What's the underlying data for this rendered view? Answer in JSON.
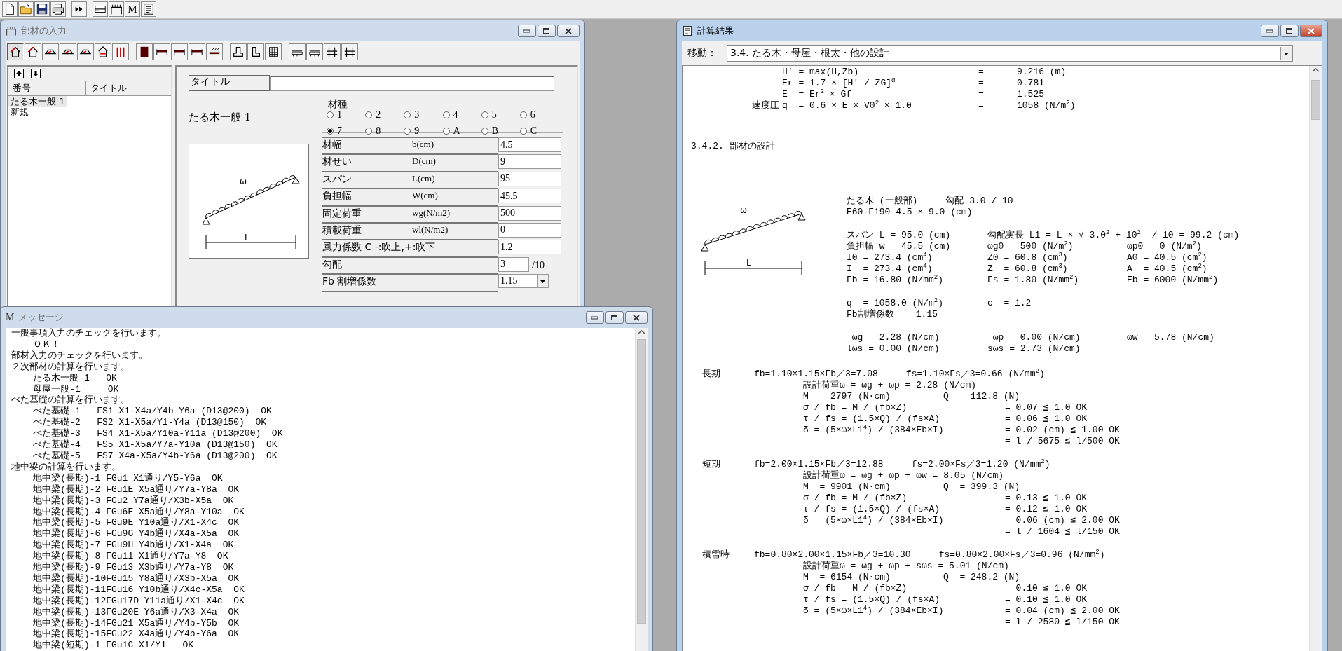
{
  "app_toolbar": {
    "groups": [
      [
        {
          "kind": "page"
        },
        {
          "kind": "folder"
        },
        {
          "kind": "floppy"
        },
        {
          "kind": "printer"
        }
      ],
      [
        {
          "kind": "fast-forward"
        }
      ],
      [
        {
          "kind": "stack"
        },
        {
          "kind": "bench"
        },
        {
          "kind": "letter",
          "text": "M"
        },
        {
          "kind": "document"
        }
      ]
    ]
  },
  "member_window": {
    "title": "部材の入力",
    "tool_groups": [
      [
        {
          "kind": "roof",
          "selected": true
        },
        {
          "kind": "roof",
          "selected": false
        },
        {
          "kind": "hip-roof",
          "selected": false
        },
        {
          "kind": "hip-roof",
          "selected": false
        },
        {
          "kind": "hip-roof",
          "selected": false
        },
        {
          "kind": "house",
          "selected": false
        },
        {
          "kind": "columns",
          "selected": false
        }
      ],
      [
        {
          "kind": "post",
          "selected": false
        },
        {
          "kind": "beam",
          "selected": false
        },
        {
          "kind": "beam",
          "selected": false
        },
        {
          "kind": "beam",
          "selected": false
        },
        {
          "kind": "load",
          "selected": false
        }
      ],
      [
        {
          "kind": "footing",
          "selected": false
        },
        {
          "kind": "l-shape",
          "selected": false
        },
        {
          "kind": "grid",
          "selected": false
        }
      ],
      [
        {
          "kind": "slab",
          "selected": false
        },
        {
          "kind": "slab",
          "selected": false
        },
        {
          "kind": "frame",
          "selected": false
        },
        {
          "kind": "frame",
          "selected": false
        }
      ]
    ],
    "list": {
      "columns": [
        "番号",
        "タイトル"
      ],
      "items": [
        {
          "text": "たる木一般 1",
          "selected": true
        },
        {
          "text": "新規",
          "selected": false
        }
      ]
    },
    "form": {
      "title_label": "タイトル",
      "heading": "たる木一般 1",
      "material": {
        "label": "材種",
        "options": [
          {
            "label": "1",
            "selected": false
          },
          {
            "label": "2",
            "selected": false
          },
          {
            "label": "3",
            "selected": false
          },
          {
            "label": "4",
            "selected": false
          },
          {
            "label": "5",
            "selected": false
          },
          {
            "label": "6",
            "selected": false
          },
          {
            "label": "7",
            "selected": true
          },
          {
            "label": "8",
            "selected": false
          },
          {
            "label": "9",
            "selected": false
          },
          {
            "label": "A",
            "selected": false
          },
          {
            "label": "B",
            "selected": false
          },
          {
            "label": "C",
            "selected": false
          }
        ]
      },
      "diagram": {
        "load_label": "ω",
        "span_label": "L"
      },
      "rows": [
        {
          "kind": "text",
          "label": "材幅",
          "unit": "b(cm)",
          "value": "4.5"
        },
        {
          "kind": "text",
          "label": "材せい",
          "unit": "D(cm)",
          "value": "9"
        },
        {
          "kind": "text",
          "label": "スパン",
          "unit": "L(cm)",
          "value": "95"
        },
        {
          "kind": "text",
          "label": "負担幅",
          "unit": "W(cm)",
          "value": "45.5"
        },
        {
          "kind": "text",
          "label": "固定荷重",
          "unit": "wg(N/m2)",
          "value": "500"
        },
        {
          "kind": "text",
          "label": "積載荷重",
          "unit": "wl(N/m2)",
          "value": "0"
        },
        {
          "kind": "text",
          "label": "風力係数 C  -:吹上,+:吹下",
          "value": "1.2"
        },
        {
          "kind": "fraction",
          "label": "勾配",
          "value": "3",
          "suffix": "/10"
        },
        {
          "kind": "select",
          "label": "Fb 割増係数",
          "value": "1.15"
        }
      ]
    }
  },
  "message_window": {
    "title_icon": "M",
    "title": "メッセージ",
    "lines": [
      "一般事項入力のチェックを行います。",
      "    ＯＫ！",
      "部材入力のチェックを行います。",
      "２次部材の計算を行います。",
      "    たる木一般-1   OK",
      "    母屋一般-1     OK",
      "べた基礎の計算を行います。",
      "    べた基礎-1   FS1 X1-X4a/Y4b-Y6a (D13@200)  OK",
      "    べた基礎-2   FS2 X1-X5a/Y1-Y4a (D13@150)  OK",
      "    べた基礎-3   FS4 X1-X5a/Y10a-Y11a (D13@200)  OK",
      "    べた基礎-4   FS5 X1-X5a/Y7a-Y10a (D13@150)  OK",
      "    べた基礎-5   FS7 X4a-X5a/Y4b-Y6a (D13@200)  OK",
      "地中梁の計算を行います。",
      "    地中梁(長期)-1 FGu1 X1通り/Y5-Y6a  OK",
      "    地中梁(長期)-2 FGu1E X5a通り/Y7a-Y8a  OK",
      "    地中梁(長期)-3 FGu2 Y7a通り/X3b-X5a  OK",
      "    地中梁(長期)-4 FGu6E X5a通り/Y8a-Y10a  OK",
      "    地中梁(長期)-5 FGu9E Y10a通り/X1-X4c  OK",
      "    地中梁(長期)-6 FGu9G Y4b通り/X4a-X5a  OK",
      "    地中梁(長期)-7 FGu9H Y4b通り/X1-X4a  OK",
      "    地中梁(長期)-8 FGu11 X1通り/Y7a-Y8  OK",
      "    地中梁(長期)-9 FGu13 X3b通り/Y7a-Y8  OK",
      "    地中梁(長期)-10FGu15 Y8a通り/X3b-X5a  OK",
      "    地中梁(長期)-11FGu16 Y10b通り/X4c-X5a  OK",
      "    地中梁(長期)-12FGu17D Y11a通り/X1-X4c  OK",
      "    地中梁(長期)-13FGu20E Y6a通り/X3-X4a  OK",
      "    地中梁(長期)-14FGu21 X5a通り/Y4b-Y5b  OK",
      "    地中梁(長期)-15FGu22 X4a通り/Y4b-Y6a  OK",
      "    地中梁(短期)-1 FGu1C X1/Y1   OK"
    ]
  },
  "results_window": {
    "title": "計算結果",
    "jump_label": "移動：",
    "jump_value": "3.4. たる木・母屋・根太・他の設計",
    "formulas": [
      {
        "expr": "H' = max(H,Zb)",
        "eq": "=",
        "value": "9.216 (m)"
      },
      {
        "expr": "Er = 1.7 × [H' / ZG]$^{α}$",
        "eq": "=",
        "value": "0.781"
      },
      {
        "expr": "E  = Er$^{2}$ × Gf",
        "eq": "=",
        "value": "1.525"
      },
      {
        "label": "速度圧",
        "expr": "q  = 0.6 × E × V0$^{2}$ × 1.0",
        "eq": "=",
        "value": "1058 (N/m$^{2}$)"
      }
    ],
    "section_heading": "3.4.2. 部材の設計",
    "member": {
      "diagram": {
        "load_label": "ω",
        "span_label": "L"
      },
      "name": "たる木 (一般部)",
      "slope": "勾配 3.0 / 10",
      "spec": "E60-F190 4.5 × 9.0 (cm)",
      "row_groups": [
        [
          [
            "スパン L = 95.0 (cm)",
            "勾配実長 L1 = L × √ 3.0$^{2}$ + 10$^{2}$  / 10 = 99.2 (cm)"
          ],
          [
            "負担幅 w = 45.5 (cm)",
            "ωg0 = 500 (N/m$^{2}$)",
            "ωp0 = 0 (N/m$^{2}$)"
          ],
          [
            "I0 = 273.4 (cm$^{4}$)",
            "Z0 = 60.8 (cm$^{3}$)",
            "A0 = 40.5 (cm$^{2}$)"
          ],
          [
            "I  = 273.4 (cm$^{4}$)",
            "Z  = 60.8 (cm$^{3}$)",
            "A  = 40.5 (cm$^{2}$)"
          ],
          [
            "Fb = 16.80 (N/mm$^{2}$)",
            "Fs = 1.80 (N/mm$^{2}$)",
            "Eb = 6000 (N/mm$^{2}$)"
          ]
        ],
        [
          [
            "q  = 1058.0 (N/m$^{2}$)",
            "c  = 1.2"
          ],
          [
            "Fb割増係数  = 1.15"
          ]
        ],
        [
          [
            " ωg = 2.28 (N/cm)",
            " ωp = 0.00 (N/cm)",
            "ωw = 5.78 (N/cm)"
          ],
          [
            "lωs = 0.00 (N/cm)",
            "sωs = 2.73 (N/cm)"
          ]
        ]
      ]
    },
    "checks": [
      {
        "label": "長期",
        "fb": "fb=1.10×1.15×Fb／3=7.08",
        "fs": "fs=1.10×Fs／3=0.66 (N/mm$^{2}$)",
        "rows": [
          {
            "kind": "line",
            "cells": [
              "設計荷重ω = ωg + ωp = 2.28 (N/cm)"
            ]
          },
          {
            "kind": "pair",
            "cells": [
              "M  = 2797 (N·cm)",
              "Q  = 112.8 (N)"
            ]
          },
          {
            "kind": "check",
            "cells": [
              "σ / fb = M / (fb×Z)",
              "= 0.07 ≦ 1.0 OK"
            ]
          },
          {
            "kind": "check",
            "cells": [
              "τ / fs = (1.5×Q) / (fs×A)",
              "= 0.06 ≦ 1.0 OK"
            ]
          },
          {
            "kind": "check",
            "cells": [
              "δ = (5×ω×L1$^{4}$) / (384×Eb×I)",
              "= 0.02 (cm) ≦ 1.00 OK"
            ]
          },
          {
            "kind": "check",
            "cells": [
              "",
              "= l / 5675 ≦ l/500 OK"
            ]
          }
        ]
      },
      {
        "label": "短期",
        "fb": "fb=2.00×1.15×Fb／3=12.88",
        "fs": "fs=2.00×Fs／3=1.20 (N/mm$^{2}$)",
        "rows": [
          {
            "kind": "line",
            "cells": [
              "設計荷重ω = ωg + ωp + ωw = 8.05 (N/cm)"
            ]
          },
          {
            "kind": "pair",
            "cells": [
              "M  = 9901 (N·cm)",
              "Q  = 399.3 (N)"
            ]
          },
          {
            "kind": "check",
            "cells": [
              "σ / fb = M / (fb×Z)",
              "= 0.13 ≦ 1.0 OK"
            ]
          },
          {
            "kind": "check",
            "cells": [
              "τ / fs = (1.5×Q) / (fs×A)",
              "= 0.12 ≦ 1.0 OK"
            ]
          },
          {
            "kind": "check",
            "cells": [
              "δ = (5×ω×L1$^{4}$) / (384×Eb×I)",
              "= 0.06 (cm) ≦ 2.00 OK"
            ]
          },
          {
            "kind": "check",
            "cells": [
              "",
              "= l / 1604 ≦ l/150 OK"
            ]
          }
        ]
      },
      {
        "label": "積雪時",
        "fb": "fb=0.80×2.00×1.15×Fb／3=10.30",
        "fs": "fs=0.80×2.00×Fs／3=0.96 (N/mm$^{2}$)",
        "rows": [
          {
            "kind": "line",
            "cells": [
              "設計荷重ω = ωg + ωp + sωs = 5.01 (N/cm)"
            ]
          },
          {
            "kind": "pair",
            "cells": [
              "M  = 6154 (N·cm)",
              "Q  = 248.2 (N)"
            ]
          },
          {
            "kind": "check",
            "cells": [
              "σ / fb = M / (fb×Z)",
              "= 0.10 ≦ 1.0 OK"
            ]
          },
          {
            "kind": "check",
            "cells": [
              "τ / fs = (1.5×Q) / (fs×A)",
              "= 0.10 ≦ 1.0 OK"
            ]
          },
          {
            "kind": "check",
            "cells": [
              "δ = (5×ω×L1$^{4}$) / (384×Eb×I)",
              "= 0.04 (cm) ≦ 2.00 OK"
            ]
          },
          {
            "kind": "check",
            "cells": [
              "",
              "= l / 2580 ≦ l/150 OK"
            ]
          }
        ]
      }
    ]
  }
}
